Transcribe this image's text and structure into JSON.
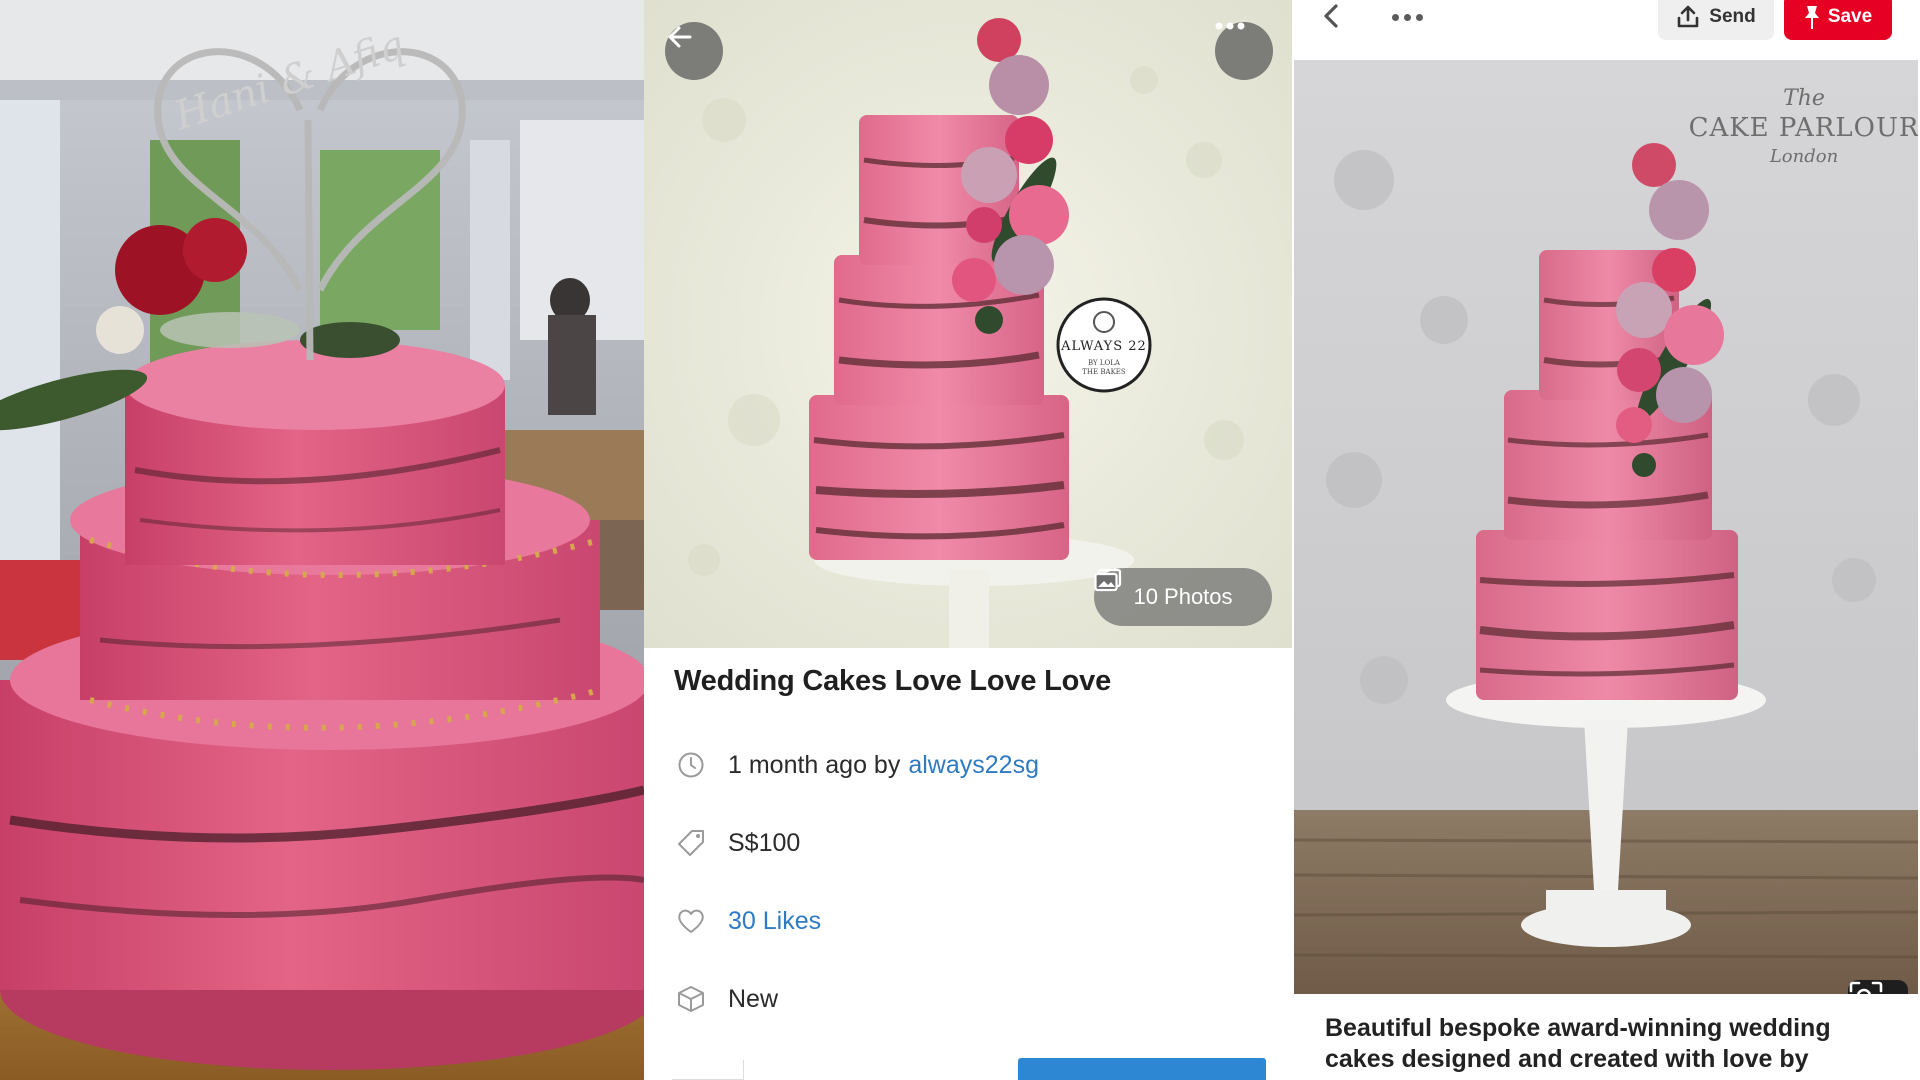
{
  "left_photo": {
    "topper_text": "Hani & Afiq"
  },
  "listing": {
    "hero_badge": {
      "name": "ALWAYS 22",
      "sub1": "BY LOLA",
      "sub2": "THE BAKES"
    },
    "photos_label": "10 Photos",
    "title": "Wedding Cakes Love Love Love",
    "posted_time": "1 month ago by",
    "seller": "always22sg",
    "price": "S$100",
    "likes": "30 Likes",
    "condition": "New",
    "icons": {
      "back": "arrow-left-icon",
      "more": "more-dots-icon",
      "photos": "gallery-icon",
      "time": "clock-icon",
      "price": "price-tag-icon",
      "likes": "heart-icon",
      "condition": "box-icon"
    }
  },
  "pin": {
    "send_label": "Send",
    "save_label": "Save",
    "watermark_line1": "The",
    "watermark_line2": "CAKE PARLOUR",
    "watermark_line3": "London",
    "description": "Beautiful bespoke award-winning wedding cakes designed and created with love by",
    "icons": {
      "back": "chevron-left-icon",
      "more": "more-dots-icon",
      "send": "share-upload-icon",
      "save": "pushpin-icon",
      "lens": "visual-search-icon"
    }
  },
  "colors": {
    "save_red": "#e60023",
    "link_blue": "#2f7bc2",
    "cake_pink": "#e0708a"
  }
}
